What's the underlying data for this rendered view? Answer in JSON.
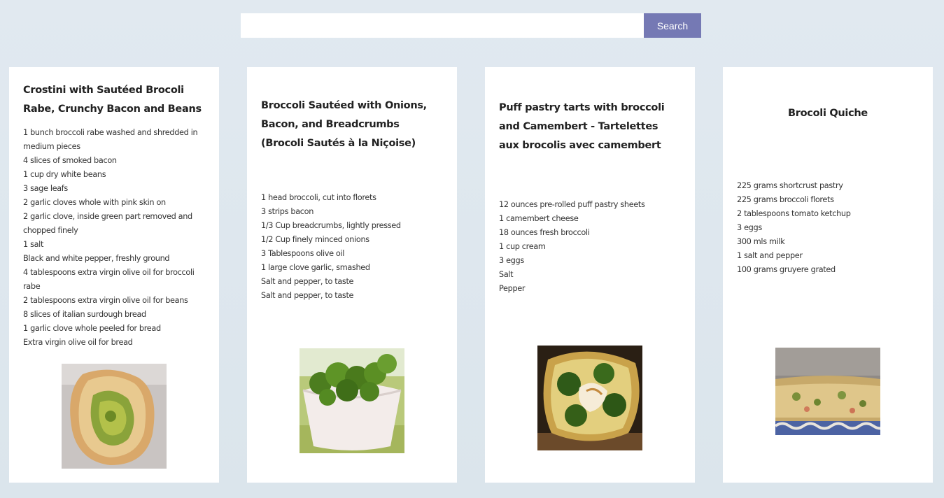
{
  "search": {
    "value": "",
    "placeholder": "",
    "button_label": "Search"
  },
  "recipes": [
    {
      "title": "Crostini with Sautéed Brocoli Rabe, Crunchy Bacon and Beans",
      "ingredients": [
        "1 bunch broccoli rabe washed and shredded in medium pieces",
        "4 slices of smoked bacon",
        "1 cup dry white beans",
        "3 sage leafs",
        "2 garlic cloves whole with pink skin on",
        "2 garlic clove, inside green part removed and chopped finely",
        "1 salt",
        "Black and white pepper, freshly ground",
        "4 tablespoons extra virgin olive oil for broccoli rabe",
        "2 tablespoons extra virgin olive oil for beans",
        "8 slices of italian surdough bread",
        "1 garlic clove whole peeled for bread",
        "Extra virgin olive oil for bread"
      ]
    },
    {
      "title": "Broccoli Sautéed with Onions, Bacon, and Breadcrumbs (Brocoli Sautés à la Niçoise)",
      "ingredients": [
        "1 head broccoli, cut into florets",
        "3 strips bacon",
        "1/3 Cup breadcrumbs, lightly pressed",
        "1/2 Cup finely minced onions",
        "3 Tablespoons olive oil",
        "1 large clove garlic, smashed",
        "Salt and pepper, to taste",
        "Salt and pepper, to taste"
      ]
    },
    {
      "title": "Puff pastry tarts with broccoli and Camembert - Tartelettes aux brocolis avec camembert",
      "ingredients": [
        "12 ounces pre-rolled puff pastry sheets",
        "1 camembert cheese",
        "18 ounces fresh broccoli",
        "1 cup cream",
        "3 eggs",
        "Salt",
        "Pepper"
      ]
    },
    {
      "title": "Brocoli Quiche",
      "ingredients": [
        "225 grams shortcrust pastry",
        "225 grams broccoli florets",
        "2 tablespoons tomato ketchup",
        "3 eggs",
        "300 mls milk",
        "1 salt and pepper",
        "100 grams gruyere grated"
      ]
    }
  ]
}
